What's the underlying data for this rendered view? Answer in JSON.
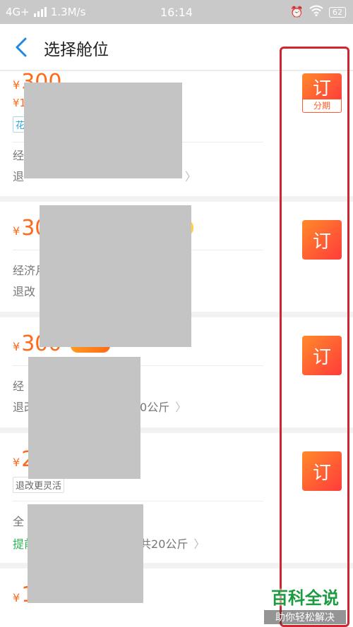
{
  "status_bar": {
    "network": "4G+",
    "speed": "1.3M/s",
    "time": "16:14",
    "battery": "62"
  },
  "nav": {
    "title": "选择舱位"
  },
  "cards": [
    {
      "price_symbol": "¥",
      "price": "300",
      "sub_price": "¥1",
      "tag": "花",
      "cabin": "经",
      "rule": "退",
      "book_label": "订",
      "installment": "分期"
    },
    {
      "price_symbol": "¥",
      "price": "30",
      "cabin": "经济月",
      "rule": "退改",
      "book_label": "订"
    },
    {
      "price_symbol": "¥",
      "price": "300",
      "cabin": "经",
      "rule": "退改",
      "rule_tail": "0公斤",
      "book_label": "订"
    },
    {
      "price_symbol": "¥",
      "price": "2",
      "tag": "退改更灵活",
      "cabin": "全",
      "rule": "提前",
      "rule_tail": "共20公斤",
      "book_label": "订"
    },
    {
      "price_symbol": "¥",
      "price": "1"
    }
  ],
  "watermark": {
    "line1": "百科全说",
    "line2": "助你轻松解决"
  },
  "colors": {
    "price": "#ff6a1a",
    "button": "#ff5a2a",
    "highlight": "#d0262f"
  }
}
